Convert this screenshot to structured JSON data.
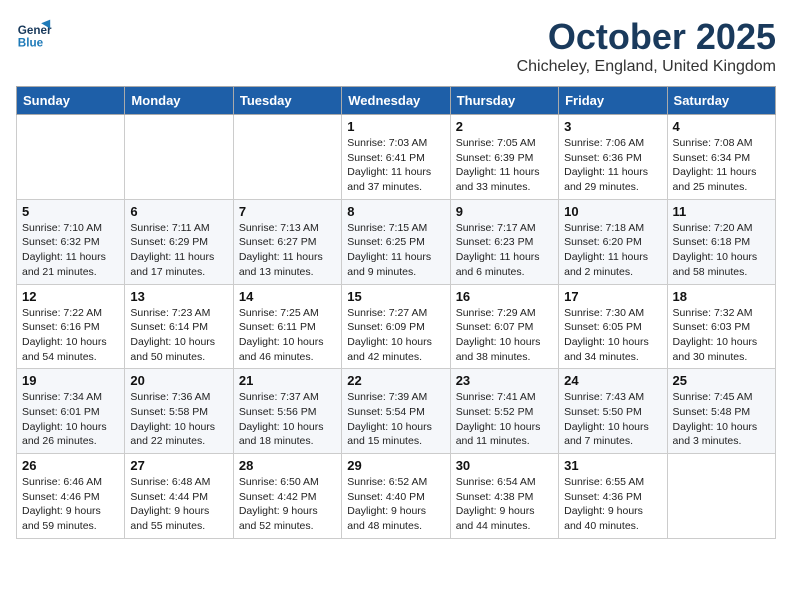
{
  "header": {
    "logo": {
      "line1": "General",
      "line2": "Blue"
    },
    "title": "October 2025",
    "location": "Chicheley, England, United Kingdom"
  },
  "weekdays": [
    "Sunday",
    "Monday",
    "Tuesday",
    "Wednesday",
    "Thursday",
    "Friday",
    "Saturday"
  ],
  "weeks": [
    [
      {
        "day": null,
        "content": null
      },
      {
        "day": null,
        "content": null
      },
      {
        "day": null,
        "content": null
      },
      {
        "day": "1",
        "content": "Sunrise: 7:03 AM\nSunset: 6:41 PM\nDaylight: 11 hours\nand 37 minutes."
      },
      {
        "day": "2",
        "content": "Sunrise: 7:05 AM\nSunset: 6:39 PM\nDaylight: 11 hours\nand 33 minutes."
      },
      {
        "day": "3",
        "content": "Sunrise: 7:06 AM\nSunset: 6:36 PM\nDaylight: 11 hours\nand 29 minutes."
      },
      {
        "day": "4",
        "content": "Sunrise: 7:08 AM\nSunset: 6:34 PM\nDaylight: 11 hours\nand 25 minutes."
      }
    ],
    [
      {
        "day": "5",
        "content": "Sunrise: 7:10 AM\nSunset: 6:32 PM\nDaylight: 11 hours\nand 21 minutes."
      },
      {
        "day": "6",
        "content": "Sunrise: 7:11 AM\nSunset: 6:29 PM\nDaylight: 11 hours\nand 17 minutes."
      },
      {
        "day": "7",
        "content": "Sunrise: 7:13 AM\nSunset: 6:27 PM\nDaylight: 11 hours\nand 13 minutes."
      },
      {
        "day": "8",
        "content": "Sunrise: 7:15 AM\nSunset: 6:25 PM\nDaylight: 11 hours\nand 9 minutes."
      },
      {
        "day": "9",
        "content": "Sunrise: 7:17 AM\nSunset: 6:23 PM\nDaylight: 11 hours\nand 6 minutes."
      },
      {
        "day": "10",
        "content": "Sunrise: 7:18 AM\nSunset: 6:20 PM\nDaylight: 11 hours\nand 2 minutes."
      },
      {
        "day": "11",
        "content": "Sunrise: 7:20 AM\nSunset: 6:18 PM\nDaylight: 10 hours\nand 58 minutes."
      }
    ],
    [
      {
        "day": "12",
        "content": "Sunrise: 7:22 AM\nSunset: 6:16 PM\nDaylight: 10 hours\nand 54 minutes."
      },
      {
        "day": "13",
        "content": "Sunrise: 7:23 AM\nSunset: 6:14 PM\nDaylight: 10 hours\nand 50 minutes."
      },
      {
        "day": "14",
        "content": "Sunrise: 7:25 AM\nSunset: 6:11 PM\nDaylight: 10 hours\nand 46 minutes."
      },
      {
        "day": "15",
        "content": "Sunrise: 7:27 AM\nSunset: 6:09 PM\nDaylight: 10 hours\nand 42 minutes."
      },
      {
        "day": "16",
        "content": "Sunrise: 7:29 AM\nSunset: 6:07 PM\nDaylight: 10 hours\nand 38 minutes."
      },
      {
        "day": "17",
        "content": "Sunrise: 7:30 AM\nSunset: 6:05 PM\nDaylight: 10 hours\nand 34 minutes."
      },
      {
        "day": "18",
        "content": "Sunrise: 7:32 AM\nSunset: 6:03 PM\nDaylight: 10 hours\nand 30 minutes."
      }
    ],
    [
      {
        "day": "19",
        "content": "Sunrise: 7:34 AM\nSunset: 6:01 PM\nDaylight: 10 hours\nand 26 minutes."
      },
      {
        "day": "20",
        "content": "Sunrise: 7:36 AM\nSunset: 5:58 PM\nDaylight: 10 hours\nand 22 minutes."
      },
      {
        "day": "21",
        "content": "Sunrise: 7:37 AM\nSunset: 5:56 PM\nDaylight: 10 hours\nand 18 minutes."
      },
      {
        "day": "22",
        "content": "Sunrise: 7:39 AM\nSunset: 5:54 PM\nDaylight: 10 hours\nand 15 minutes."
      },
      {
        "day": "23",
        "content": "Sunrise: 7:41 AM\nSunset: 5:52 PM\nDaylight: 10 hours\nand 11 minutes."
      },
      {
        "day": "24",
        "content": "Sunrise: 7:43 AM\nSunset: 5:50 PM\nDaylight: 10 hours\nand 7 minutes."
      },
      {
        "day": "25",
        "content": "Sunrise: 7:45 AM\nSunset: 5:48 PM\nDaylight: 10 hours\nand 3 minutes."
      }
    ],
    [
      {
        "day": "26",
        "content": "Sunrise: 6:46 AM\nSunset: 4:46 PM\nDaylight: 9 hours\nand 59 minutes."
      },
      {
        "day": "27",
        "content": "Sunrise: 6:48 AM\nSunset: 4:44 PM\nDaylight: 9 hours\nand 55 minutes."
      },
      {
        "day": "28",
        "content": "Sunrise: 6:50 AM\nSunset: 4:42 PM\nDaylight: 9 hours\nand 52 minutes."
      },
      {
        "day": "29",
        "content": "Sunrise: 6:52 AM\nSunset: 4:40 PM\nDaylight: 9 hours\nand 48 minutes."
      },
      {
        "day": "30",
        "content": "Sunrise: 6:54 AM\nSunset: 4:38 PM\nDaylight: 9 hours\nand 44 minutes."
      },
      {
        "day": "31",
        "content": "Sunrise: 6:55 AM\nSunset: 4:36 PM\nDaylight: 9 hours\nand 40 minutes."
      },
      {
        "day": null,
        "content": null
      }
    ]
  ]
}
